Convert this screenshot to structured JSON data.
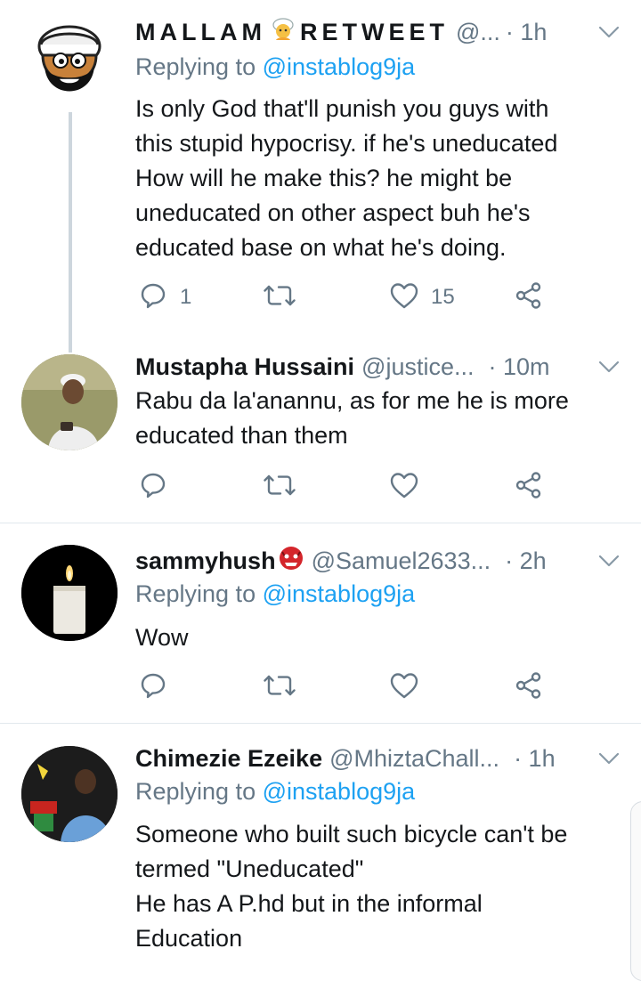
{
  "tweets": [
    {
      "name": "MALLAM",
      "name_suffix": "RETWEET",
      "handle": "@...",
      "time": "· 1h",
      "replying_prefix": "Replying to",
      "replying_mention": "@instablog9ja",
      "lines": [
        "Is only God that'll punish you guys with",
        "this stupid hypocrisy. if he's uneducated",
        "How will he make this?  he might be",
        "uneducated on other aspect buh he's",
        "educated base on what he's doing."
      ],
      "reply_count": "1",
      "like_count": "15"
    },
    {
      "name": "Mustapha Hussaini",
      "handle": "@justice...",
      "time": "· 10m",
      "lines": [
        "Rabu da la'anannu, as for me he is more",
        "educated than them"
      ]
    },
    {
      "name": "sammyhush",
      "handle": "@Samuel2633...",
      "time": "· 2h",
      "replying_prefix": "Replying to",
      "replying_mention": "@instablog9ja",
      "lines": [
        "Wow"
      ]
    },
    {
      "name": "Chimezie Ezeike",
      "handle": "@MhiztaChall...",
      "time": "· 1h",
      "replying_prefix": "Replying to",
      "replying_mention": "@instablog9ja",
      "lines": [
        "Someone who built such bicycle can't be",
        "termed \"Uneducated\"",
        "He has A P.hd but in the informal",
        "Education"
      ]
    }
  ],
  "colors": {
    "text": "#14171a",
    "secondary": "#657786",
    "link": "#1da1f2",
    "divider": "#e1e8ed",
    "thread_line": "#cdd6dd"
  },
  "icons": [
    "reply-icon",
    "retweet-icon",
    "like-icon",
    "share-icon",
    "chevron-down-icon"
  ]
}
